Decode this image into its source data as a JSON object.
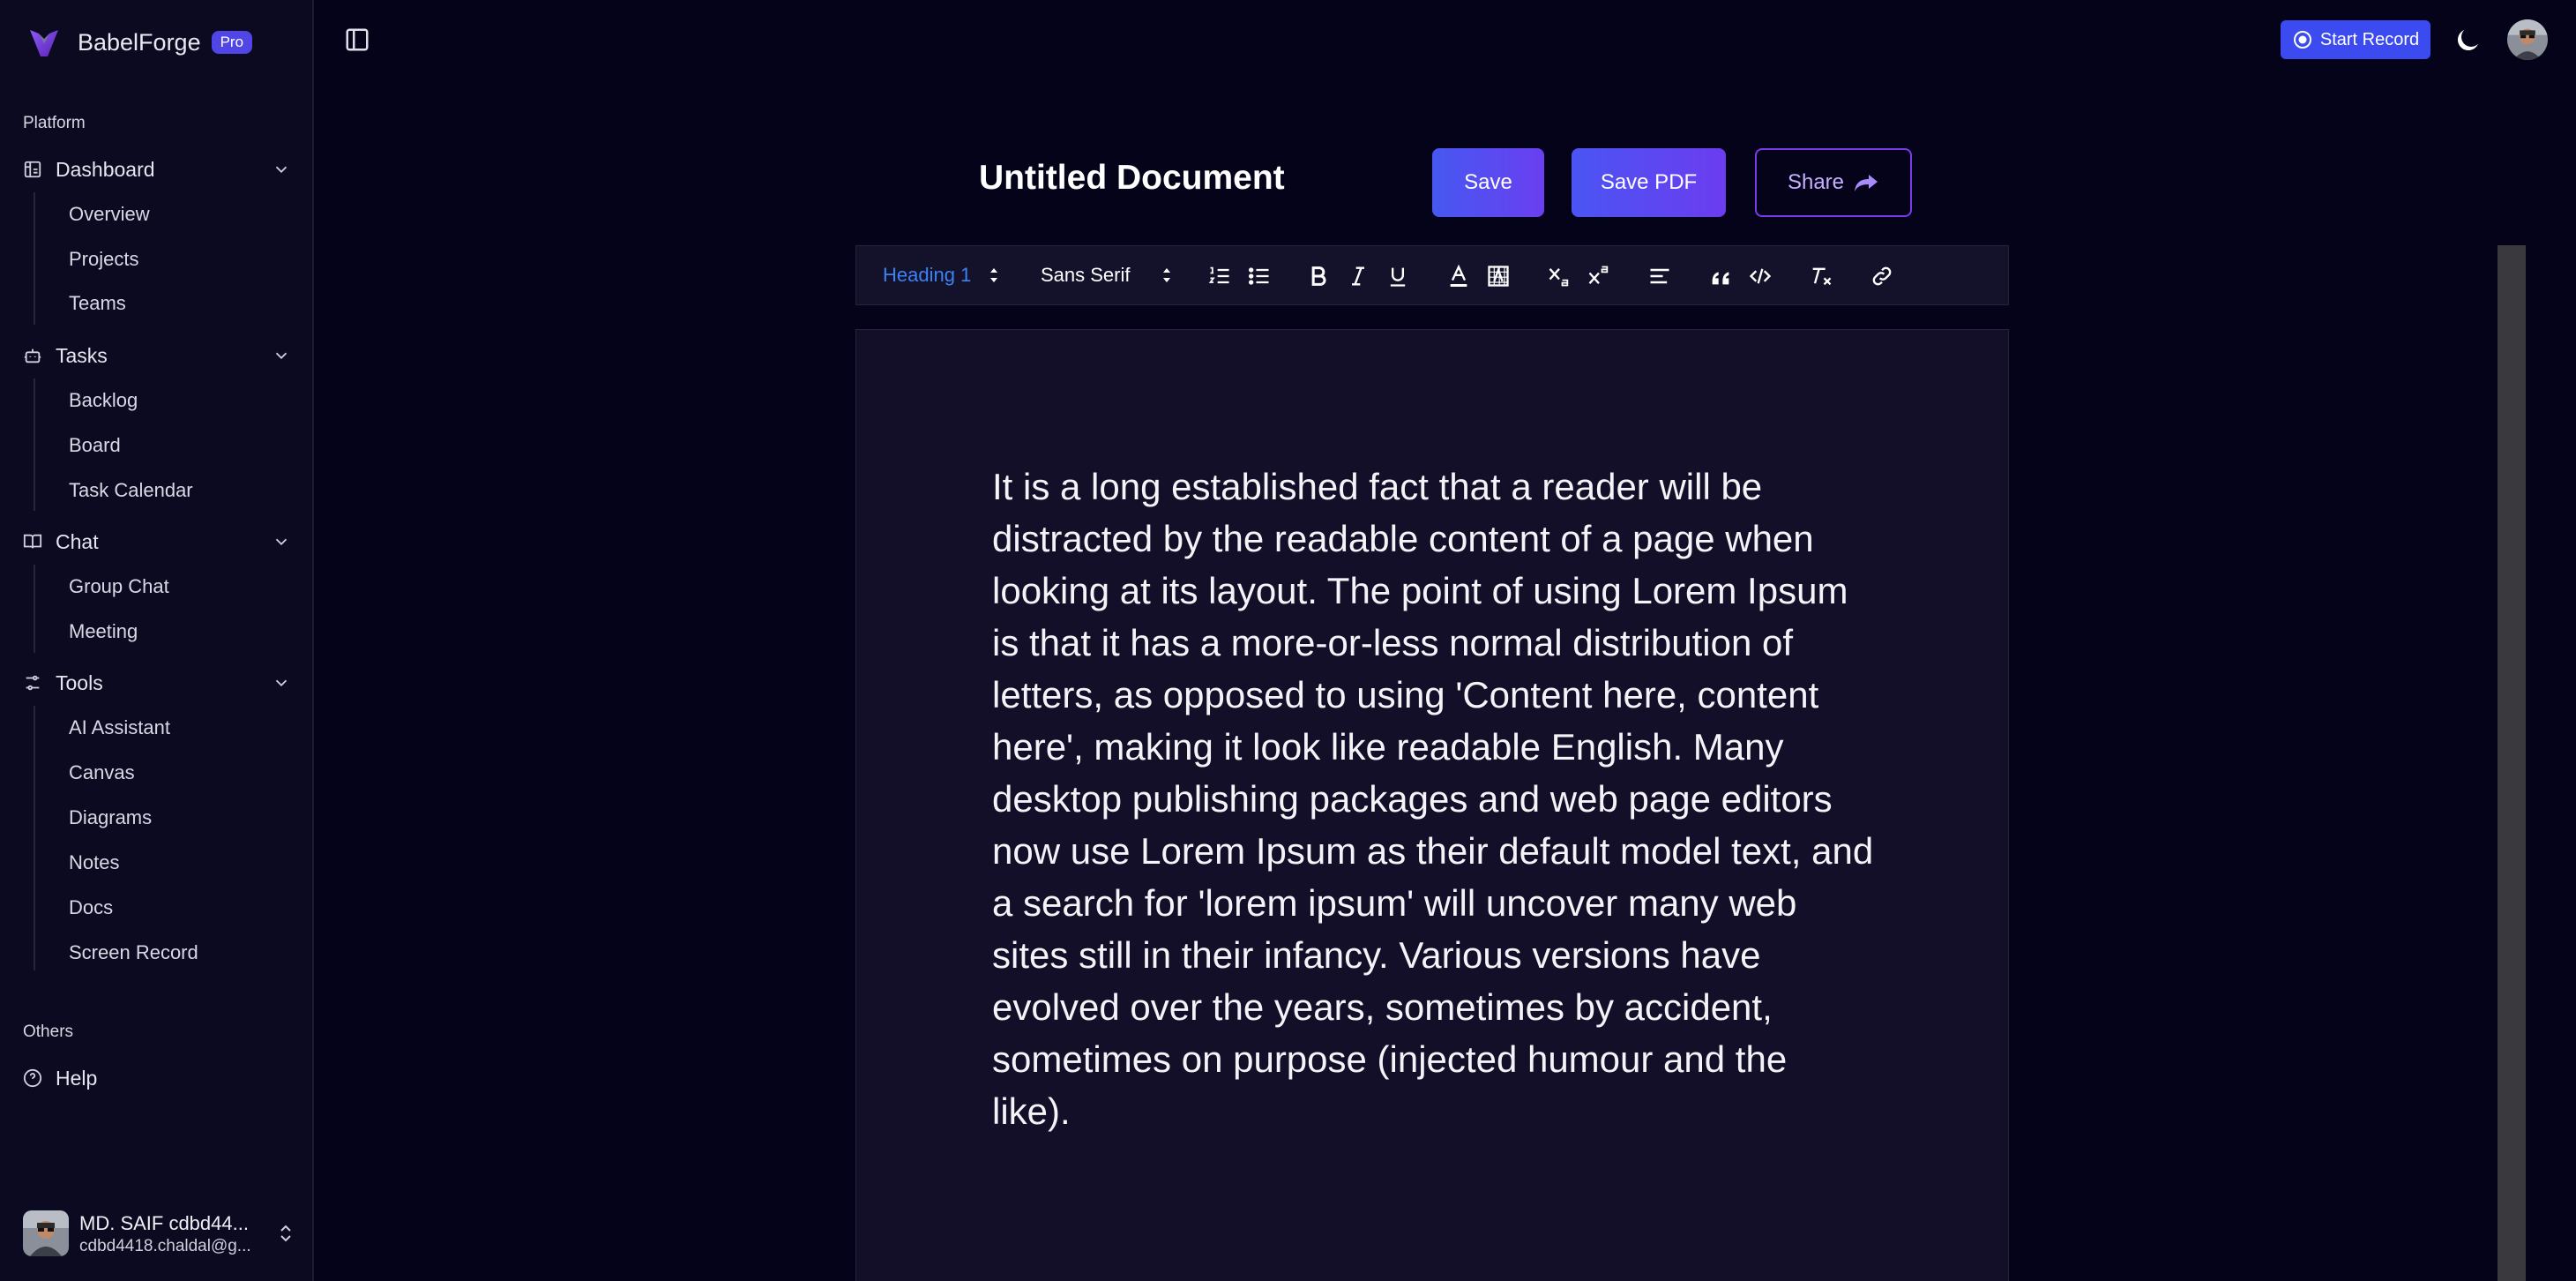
{
  "brand": {
    "name": "BabelForge",
    "badge": "Pro"
  },
  "sidebar": {
    "platform_label": "Platform",
    "groups": [
      {
        "label": "Dashboard",
        "icon": "dashboard-icon",
        "items": [
          "Overview",
          "Projects",
          "Teams"
        ]
      },
      {
        "label": "Tasks",
        "icon": "bot-icon",
        "items": [
          "Backlog",
          "Board",
          "Task Calendar"
        ]
      },
      {
        "label": "Chat",
        "icon": "book-icon",
        "items": [
          "Group Chat",
          "Meeting"
        ]
      },
      {
        "label": "Tools",
        "icon": "tools-icon",
        "items": [
          "AI Assistant",
          "Canvas",
          "Diagrams",
          "Notes",
          "Docs",
          "Screen Record"
        ]
      }
    ],
    "others_label": "Others",
    "help_label": "Help"
  },
  "user": {
    "name": "MD. SAIF cdbd44...",
    "email": "cdbd4418.chaldal@g..."
  },
  "topbar": {
    "start_record": "Start Record"
  },
  "document": {
    "title": "Untitled Document",
    "save_label": "Save",
    "save_pdf_label": "Save PDF",
    "share_label": "Share",
    "body": "It is a long established fact that a reader will be distracted by the readable content of a page when looking at its layout. The point of using Lorem Ipsum is that it has a more-or-less normal distribution of letters, as opposed to using 'Content here, content here', making it look like readable English. Many desktop publishing packages and web page editors now use Lorem Ipsum as their default model text, and a search for 'lorem ipsum' will uncover many web sites still in their infancy. Various versions have evolved over the years, sometimes by accident, sometimes on purpose (injected humour and the like)."
  },
  "toolbar": {
    "heading_value": "Heading 1",
    "font_value": "Sans Serif",
    "icons": [
      "ordered-list-icon",
      "bullet-list-icon",
      "bold-icon",
      "italic-icon",
      "underline-icon",
      "text-color-icon",
      "background-color-icon",
      "subscript-icon",
      "superscript-icon",
      "align-icon",
      "blockquote-icon",
      "code-icon",
      "clear-format-icon",
      "link-icon"
    ]
  },
  "colors": {
    "accent": "#4f46e5",
    "heading_select": "#3b82f6",
    "share_border": "#7c3aed",
    "background": "#04031a"
  }
}
